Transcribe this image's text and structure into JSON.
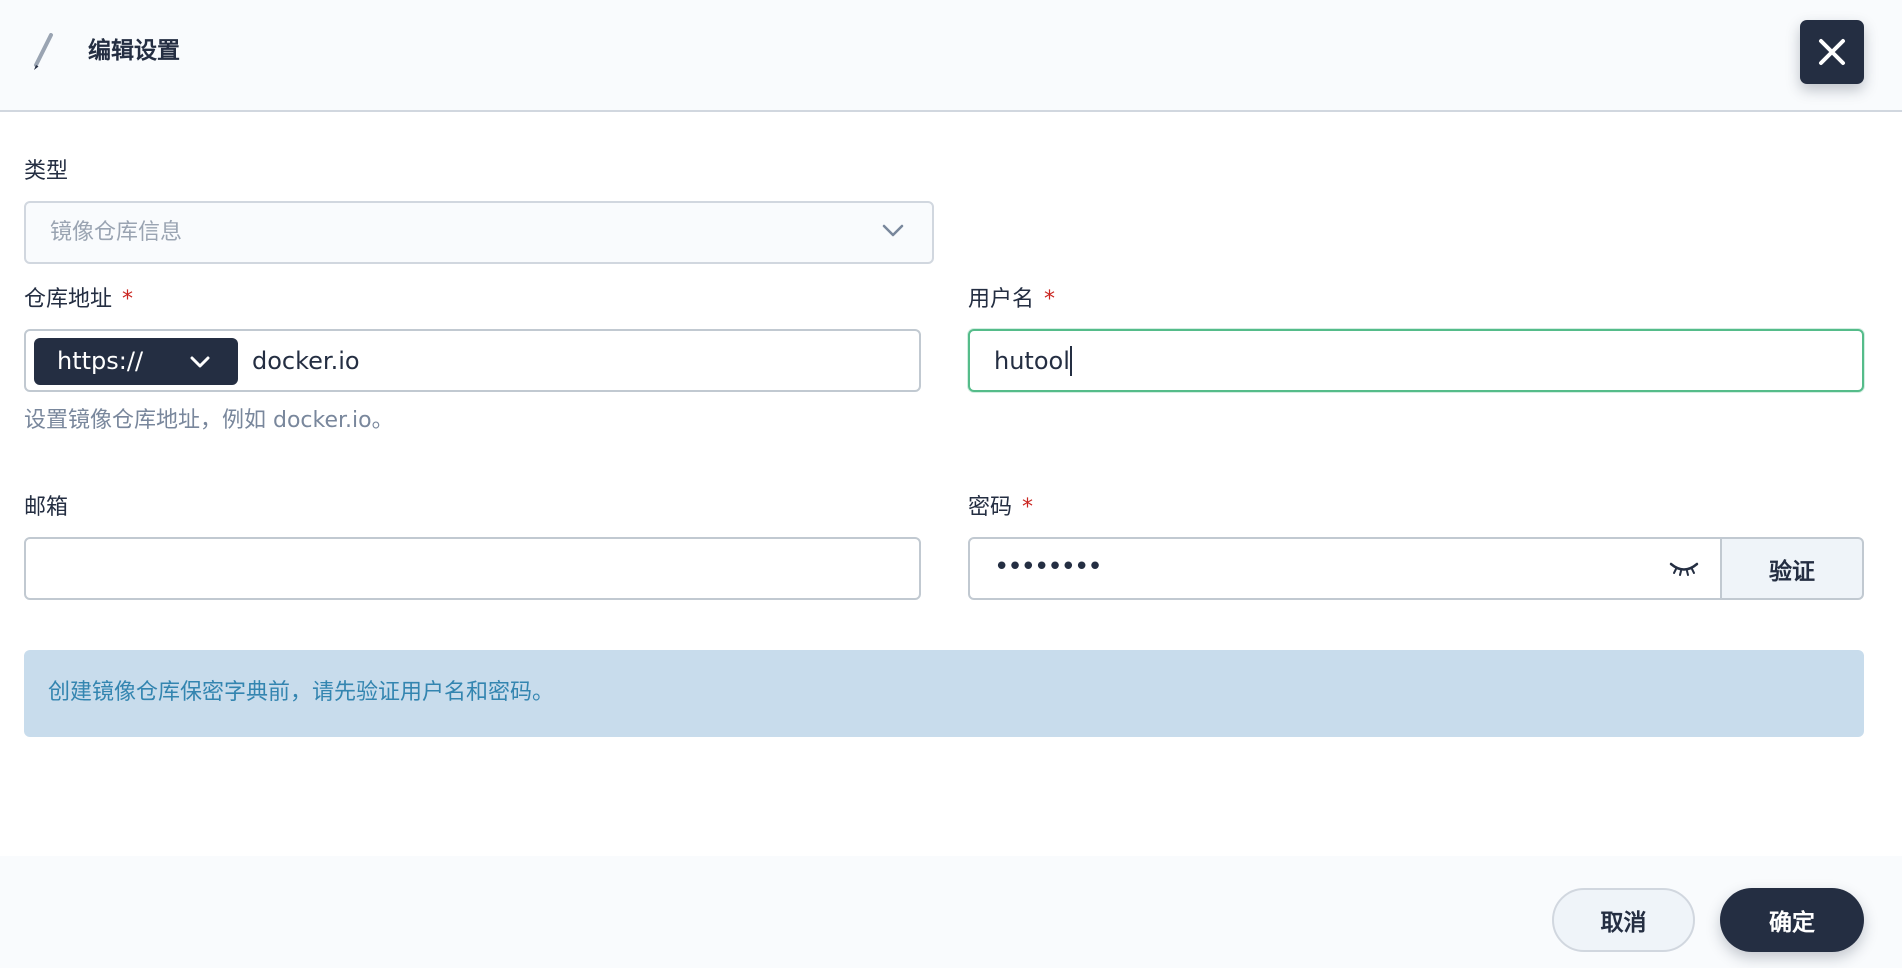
{
  "dialog": {
    "title": "编辑设置"
  },
  "form": {
    "type": {
      "label": "类型",
      "value": "镜像仓库信息"
    },
    "registry": {
      "label": "仓库地址",
      "required_mark": "*",
      "protocol": "https://",
      "value": "docker.io",
      "hint": "设置镜像仓库地址，例如 docker.io。"
    },
    "username": {
      "label": "用户名",
      "required_mark": "*",
      "value": "hutool"
    },
    "email": {
      "label": "邮箱",
      "value": ""
    },
    "password": {
      "label": "密码",
      "required_mark": "*",
      "masked_value": "••••••••",
      "verify_label": "验证"
    }
  },
  "info": {
    "text": "创建镜像仓库保密字典前，请先验证用户名和密码。"
  },
  "footer": {
    "cancel_label": "取消",
    "confirm_label": "确定"
  },
  "colors": {
    "primary_dark": "#242e42",
    "success_border": "#55bc8a",
    "required": "#ca2621",
    "info_bg": "#c8dcec",
    "info_text": "#3385b0"
  },
  "icons": {
    "title": "pencil-icon",
    "close": "close-icon",
    "dropdown": "chevron-down-icon",
    "password_toggle": "eye-closed-icon"
  }
}
